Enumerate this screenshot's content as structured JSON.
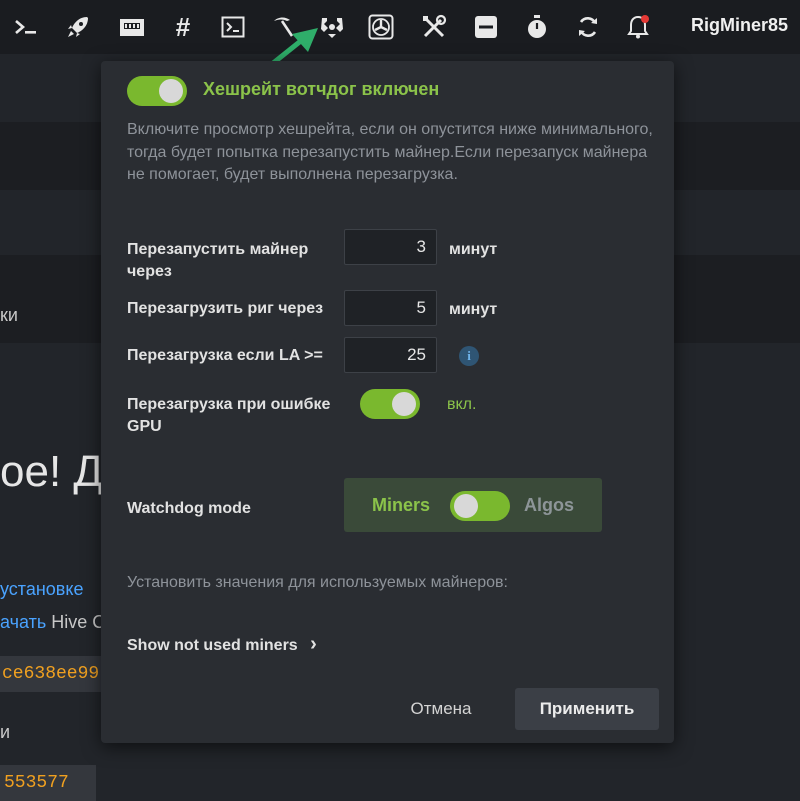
{
  "topbar": {
    "icons": [
      "terminal-icon",
      "rocket-icon",
      "network-card-icon",
      "hash-icon",
      "console-icon",
      "pickaxe-icon",
      "watchdog-icon",
      "fan-icon",
      "tools-icon",
      "minus-box-icon",
      "stopwatch-icon",
      "refresh-icon",
      "bell-icon"
    ],
    "username": "RigMiner85"
  },
  "background": {
    "text_tail": "ки",
    "big_text": "ое! Д",
    "link1": "установке",
    "link2": "ачать",
    "link2_suffix": " Hive C",
    "code1": "ce638ee99",
    "text_m": "и",
    "code2": "553577"
  },
  "modal": {
    "title": "Хешрейт вотчдог включен",
    "enabled": true,
    "description": "Включите просмотр хешрейта, если он опустится ниже минимального, тогда будет попытка перезапустить майнер.Если перезапуск майнера не помогает, будет выполнена перезагрузка.",
    "restart_miner": {
      "label": "Перезапустить майнер через",
      "value": "3",
      "unit": "минут"
    },
    "reboot_rig": {
      "label": "Перезагрузить риг через",
      "value": "5",
      "unit": "минут"
    },
    "reboot_la": {
      "label": "Перезагрузка если LA >=",
      "value": "25",
      "info": "i"
    },
    "reboot_gpu": {
      "label": "Перезагрузка при ошибке GPU",
      "state": "вкл.",
      "enabled": true
    },
    "watchdog_mode": {
      "label": "Watchdog mode",
      "left": "Miners",
      "right": "Algos"
    },
    "set_values_text": "Установить значения для используемых майнеров:",
    "show_miners": "Show not used miners",
    "show_miners_chevron": "›",
    "cancel": "Отмена",
    "apply": "Применить"
  },
  "colors": {
    "accent": "#8bc34a",
    "toggle": "#7ab82e",
    "arrow": "#2fae6a",
    "link": "#4aa3ff",
    "code": "#f0a020"
  }
}
